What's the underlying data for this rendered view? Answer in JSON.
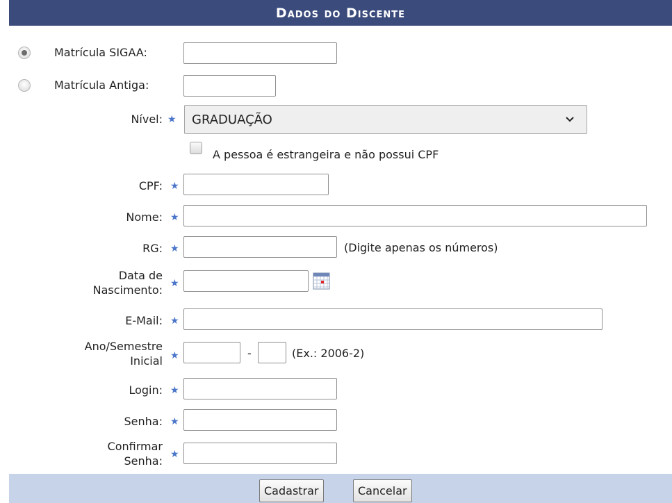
{
  "header": {
    "title": "Dados do Discente"
  },
  "matricula": {
    "sigaa_label": "Matrícula SIGAA:",
    "antiga_label": "Matrícula Antiga:",
    "selected": "sigaa"
  },
  "nivel": {
    "label": "Nível:",
    "value": "GRADUAÇÃO"
  },
  "estrangeira": {
    "label": "A pessoa é estrangeira e não possui CPF",
    "checked": false
  },
  "fields": {
    "cpf": "CPF:",
    "nome": "Nome:",
    "rg": "RG:",
    "rg_hint": "(Digite apenas os números)",
    "nascimento_line1": "Data de",
    "nascimento_line2": "Nascimento:",
    "email": "E-Mail:",
    "ano_line1": "Ano/Semestre",
    "ano_line2": "Inicial",
    "ano_sep": "-",
    "ano_hint": "(Ex.: 2006-2)",
    "login": "Login:",
    "senha": "Senha:",
    "confirmar_line1": "Confirmar",
    "confirmar_line2": "Senha:"
  },
  "buttons": {
    "cadastrar": "Cadastrar",
    "cancelar": "Cancelar"
  },
  "icons": {
    "required": "required-star-icon",
    "calendar": "calendar-icon",
    "dropdown": "chevron-down-icon"
  },
  "colors": {
    "header_bg": "#3a4b7c",
    "footer_bg": "#c7d3e8",
    "required_star": "#4a75c9"
  }
}
